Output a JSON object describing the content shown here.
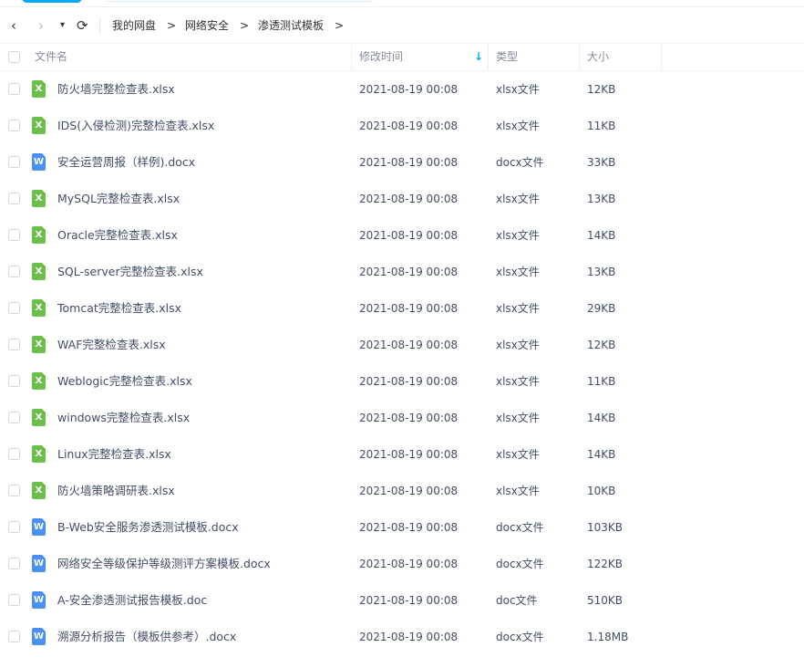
{
  "toolbar": {
    "back": "‹",
    "forward": "›",
    "dropdown": "▾",
    "refresh": "⟳"
  },
  "breadcrumb": [
    {
      "label": "我的网盘"
    },
    {
      "label": "网络安全"
    },
    {
      "label": "渗透测试模板"
    }
  ],
  "breadcrumb_sep": ">",
  "header": {
    "name": "文件名",
    "modified": "修改时间",
    "sort_icon": "↓",
    "type": "类型",
    "size": "大小"
  },
  "colors": {
    "accent": "#06a7ff",
    "xlsx": "#6cc04a",
    "docx": "#4c8ff5"
  },
  "files": [
    {
      "name": "防火墙完整检查表.xlsx",
      "date": "2021-08-19 00:08",
      "type": "xlsx文件",
      "size": "12KB",
      "kind": "xlsx",
      "glyph": "X"
    },
    {
      "name": "IDS(入侵检测)完整检查表.xlsx",
      "date": "2021-08-19 00:08",
      "type": "xlsx文件",
      "size": "11KB",
      "kind": "xlsx",
      "glyph": "X"
    },
    {
      "name": "安全运营周报（样例).docx",
      "date": "2021-08-19 00:08",
      "type": "docx文件",
      "size": "33KB",
      "kind": "docx",
      "glyph": "W"
    },
    {
      "name": "MySQL完整检查表.xlsx",
      "date": "2021-08-19 00:08",
      "type": "xlsx文件",
      "size": "13KB",
      "kind": "xlsx",
      "glyph": "X"
    },
    {
      "name": "Oracle完整检查表.xlsx",
      "date": "2021-08-19 00:08",
      "type": "xlsx文件",
      "size": "14KB",
      "kind": "xlsx",
      "glyph": "X"
    },
    {
      "name": "SQL-server完整检查表.xlsx",
      "date": "2021-08-19 00:08",
      "type": "xlsx文件",
      "size": "13KB",
      "kind": "xlsx",
      "glyph": "X"
    },
    {
      "name": "Tomcat完整检查表.xlsx",
      "date": "2021-08-19 00:08",
      "type": "xlsx文件",
      "size": "29KB",
      "kind": "xlsx",
      "glyph": "X"
    },
    {
      "name": "WAF完整检查表.xlsx",
      "date": "2021-08-19 00:08",
      "type": "xlsx文件",
      "size": "12KB",
      "kind": "xlsx",
      "glyph": "X"
    },
    {
      "name": "Weblogic完整检查表.xlsx",
      "date": "2021-08-19 00:08",
      "type": "xlsx文件",
      "size": "11KB",
      "kind": "xlsx",
      "glyph": "X"
    },
    {
      "name": "windows完整检查表.xlsx",
      "date": "2021-08-19 00:08",
      "type": "xlsx文件",
      "size": "14KB",
      "kind": "xlsx",
      "glyph": "X"
    },
    {
      "name": "Linux完整检查表.xlsx",
      "date": "2021-08-19 00:08",
      "type": "xlsx文件",
      "size": "14KB",
      "kind": "xlsx",
      "glyph": "X"
    },
    {
      "name": "防火墙策略调研表.xlsx",
      "date": "2021-08-19 00:08",
      "type": "xlsx文件",
      "size": "10KB",
      "kind": "xlsx",
      "glyph": "X"
    },
    {
      "name": "B-Web安全服务渗透测试模板.docx",
      "date": "2021-08-19 00:08",
      "type": "docx文件",
      "size": "103KB",
      "kind": "docx",
      "glyph": "W"
    },
    {
      "name": "网络安全等级保护等级测评方案模板.docx",
      "date": "2021-08-19 00:08",
      "type": "docx文件",
      "size": "122KB",
      "kind": "docx",
      "glyph": "W"
    },
    {
      "name": "A-安全渗透测试报告模板.doc",
      "date": "2021-08-19 00:08",
      "type": "doc文件",
      "size": "510KB",
      "kind": "docx",
      "glyph": "W"
    },
    {
      "name": "溯源分析报告（模板供参考）.docx",
      "date": "2021-08-19 00:08",
      "type": "docx文件",
      "size": "1.18MB",
      "kind": "docx",
      "glyph": "W"
    }
  ]
}
